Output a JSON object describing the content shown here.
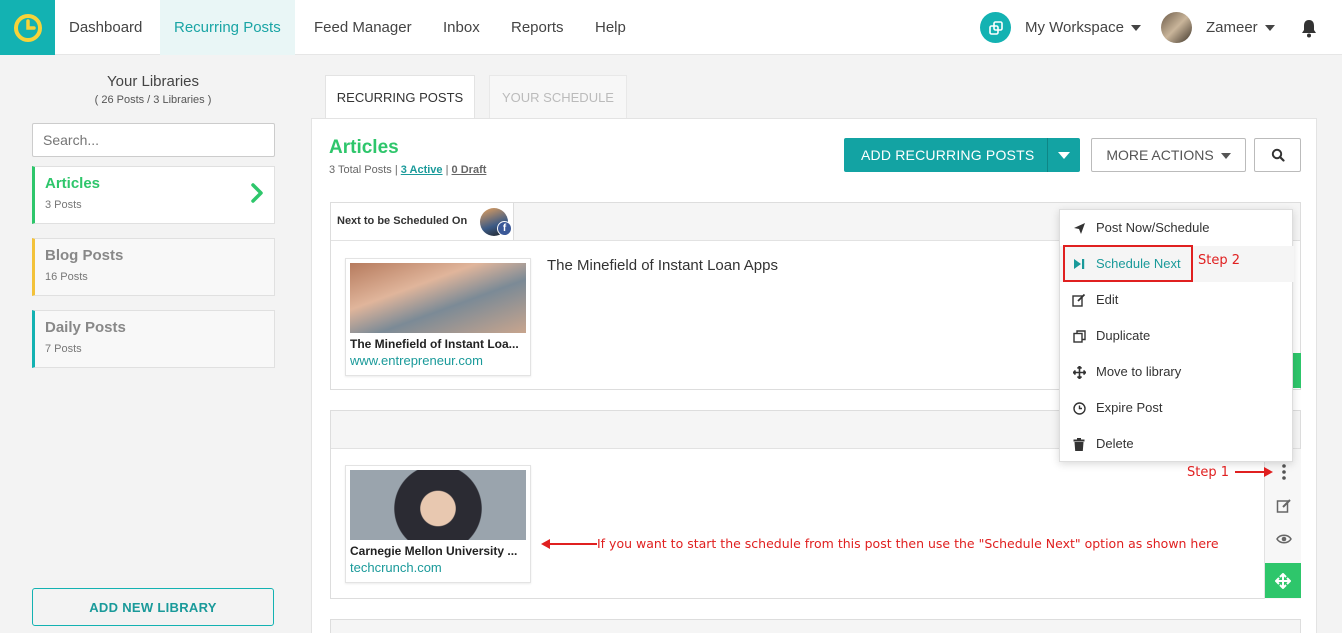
{
  "nav": {
    "items": [
      "Dashboard",
      "Recurring Posts",
      "Feed Manager",
      "Inbox",
      "Reports",
      "Help"
    ],
    "workspace": "My Workspace",
    "user": "Zameer"
  },
  "sidebar": {
    "title": "Your Libraries",
    "subtitle": "( 26 Posts / 3 Libraries )",
    "search_placeholder": "Search...",
    "libraries": [
      {
        "name": "Articles",
        "count": "3 Posts"
      },
      {
        "name": "Blog Posts",
        "count": "16 Posts"
      },
      {
        "name": "Daily Posts",
        "count": "7 Posts"
      }
    ],
    "add_button": "ADD NEW LIBRARY"
  },
  "tabs": [
    "RECURRING POSTS",
    "YOUR SCHEDULE"
  ],
  "library": {
    "title": "Articles",
    "total": "3 Total Posts",
    "active": "3 Active",
    "draft": "0 Draft",
    "add_button": "ADD RECURRING POSTS",
    "more_button": "MORE ACTIONS"
  },
  "posts": [
    {
      "next_label": "Next to be Scheduled On",
      "text": "The Minefield of Instant Loan Apps",
      "preview_title": "The Minefield of Instant Loa...",
      "preview_url": "www.entrepreneur.com"
    },
    {
      "text": "",
      "preview_title": "Carnegie Mellon University ...",
      "preview_url": "techcrunch.com"
    }
  ],
  "menu": [
    "Post Now/Schedule",
    "Schedule Next",
    "Edit",
    "Duplicate",
    "Move to library",
    "Expire Post",
    "Delete"
  ],
  "annotations": {
    "step1": "Step 1",
    "step2": "Step 2",
    "note": "If you want to start the schedule from this post then use the \"Schedule Next\" option as shown here"
  },
  "colors": {
    "brand_teal": "#13b2b2",
    "accent_green": "#2ec66b",
    "annotation_red": "#e02020"
  }
}
